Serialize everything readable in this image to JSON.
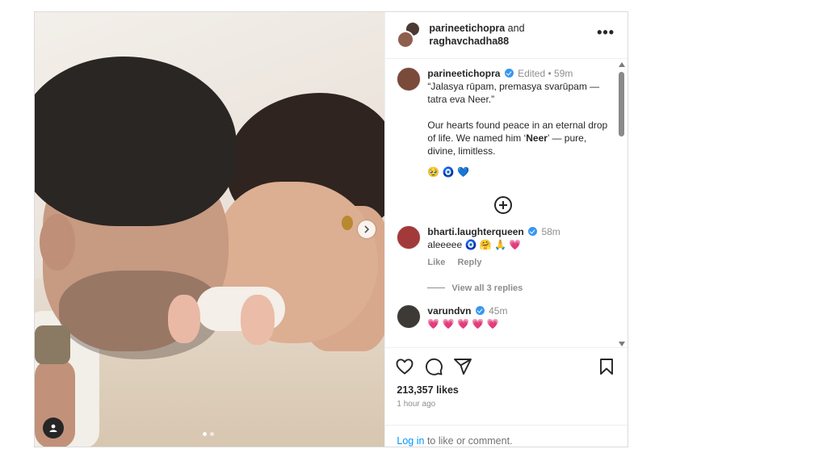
{
  "header": {
    "user1": "parineetichopra",
    "and_text": "and",
    "user2": "raghavchadha88",
    "more_label": "•••"
  },
  "caption": {
    "username": "parineetichopra",
    "edited": "Edited",
    "sep": "•",
    "time": "59m",
    "line1": "“Jalasya rūpam, premasya svarūpam — tatra eva Neer.”",
    "line2_pre": "Our hearts found peace in an eternal drop of life. We named him ‘",
    "line2_bold": "Neer",
    "line2_post": "’ — pure, divine, limitless.",
    "emojis": "🥹 🧿 💙"
  },
  "comments": [
    {
      "username": "bharti.laughterqueen",
      "time": "58m",
      "text": "aleeeee 🧿 🤗 🙏 💗",
      "like_label": "Like",
      "reply_label": "Reply",
      "view_replies": "View all 3 replies",
      "avatar_color": "#a33a3a"
    },
    {
      "username": "varundvn",
      "time": "45m",
      "text": "💗 💗 💗 💗 💗",
      "avatar_color": "#3d3a35"
    }
  ],
  "likes": "213,357 likes",
  "posted": "1 hour ago",
  "login": {
    "link": "Log in",
    "text": " to like or comment."
  },
  "colors": {
    "accent": "#0095f6",
    "verified": "#3897f0",
    "muted": "#8e8e8e"
  },
  "icons": [
    "heart-icon",
    "comment-icon",
    "share-icon",
    "bookmark-icon",
    "plus-circle-icon",
    "chevron-right-icon",
    "user-tag-icon",
    "verified-badge-icon"
  ]
}
